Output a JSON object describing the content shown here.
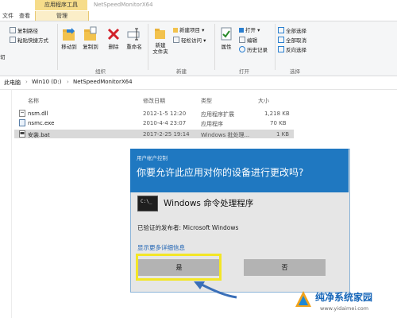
{
  "window": {
    "title": "NetSpeedMonitorX64"
  },
  "ribbon": {
    "context_group": "应用程序工具",
    "tabs": [
      "文件",
      "查看"
    ],
    "tab_manage": "管理",
    "clipboard": {
      "copy_path": "复制路径",
      "paste_shortcut": "粘贴快捷方式"
    },
    "organize": {
      "move_to": "移动到",
      "copy_to": "复制到",
      "delete": "删除",
      "rename": "重命名",
      "label": "组织"
    },
    "new": {
      "new_folder_line1": "新建",
      "new_folder_line2": "文件夹",
      "new_item": "新建项目",
      "easy_access": "轻松访问",
      "label": "新建"
    },
    "open": {
      "properties": "属性",
      "open": "打开",
      "edit": "编辑",
      "history": "历史记录",
      "label": "打开"
    },
    "select": {
      "select_all": "全部选择",
      "select_none": "全部取消",
      "invert": "反向选择",
      "label": "选择"
    },
    "left_cut": "切"
  },
  "address": {
    "crumbs": [
      "此电脑",
      "Win10 (D:)",
      "NetSpeedMonitorX64"
    ]
  },
  "columns": {
    "name": "名称",
    "modified": "修改日期",
    "type": "类型",
    "size": "大小"
  },
  "files": [
    {
      "name": "nsm.dll",
      "modified": "2012-1-5 12:20",
      "type": "应用程序扩展",
      "size": "1,218 KB"
    },
    {
      "name": "nsmc.exe",
      "modified": "2010-4-4 23:07",
      "type": "应用程序",
      "size": "70 KB"
    },
    {
      "name": "安装.bat",
      "modified": "2017-2-25 19:14",
      "type": "Windows 批处理...",
      "size": "1 KB"
    }
  ],
  "uac": {
    "caption": "用户帐户控制",
    "question": "你要允许此应用对你的设备进行更改吗?",
    "app_name": "Windows 命令处理程序",
    "publisher": "已验证的发布者: Microsoft Windows",
    "more_details": "显示更多详细信息",
    "yes": "是",
    "no": "否"
  },
  "watermark": {
    "title": "纯净系统家园",
    "url": "www.yidaimei.com"
  },
  "colors": {
    "uac_header": "#1f78c1",
    "highlight": "#f3e626",
    "link": "#1f63b3"
  }
}
